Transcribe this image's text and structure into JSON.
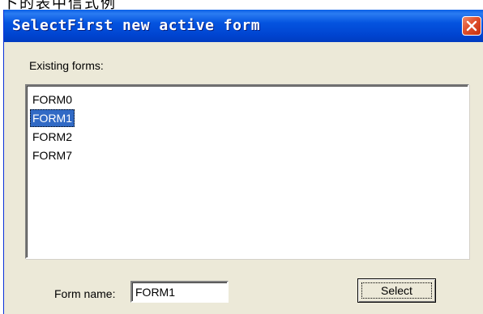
{
  "background_fragment": "卜的表中信式例",
  "window": {
    "title": "SelectFirst new active form",
    "close_icon": "close-icon",
    "colors": {
      "titlebar": "#0454e0",
      "close": "#e0502c",
      "face": "#ece9d8",
      "selection": "#316ac5"
    }
  },
  "existing_forms": {
    "label": "Existing forms:",
    "items": [
      "FORM0",
      "FORM1",
      "FORM2",
      "FORM7"
    ],
    "selected": "FORM1"
  },
  "form_name": {
    "label": "Form name:",
    "value": "FORM1"
  },
  "select_button": {
    "label": "Select"
  }
}
